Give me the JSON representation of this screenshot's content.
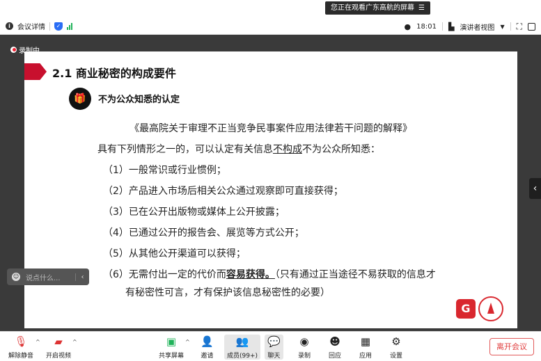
{
  "share_banner": {
    "text": "您正在观看广东高航的屏幕",
    "menu_icon": "menu-icon"
  },
  "info_bar": {
    "meeting_details": "会议详情",
    "time": "18:01",
    "view_mode": "演讲者视图",
    "colors": {
      "shield": "#2a6df5",
      "signal": "#21b35b"
    }
  },
  "recording": {
    "label": "录制中"
  },
  "slide": {
    "heading": "2.1 商业秘密的构成要件",
    "subheading": "不为公众知悉的认定",
    "law_title": "《最高院关于审理不正当竞争民事案件应用法律若干问题的解释》",
    "lead_pre": "具有下列情形之一的，可以认定有关信息",
    "lead_underline": "不构成",
    "lead_post": "不为公众所知悉：",
    "items": [
      "（1）一般常识或行业惯例；",
      "（2）产品进入市场后相关公众通过观察即可直接获得；",
      "（3）已在公开出版物或媒体上公开披露；",
      "（4）已通过公开的报告会、展览等方式公开；",
      "（5）从其他公开渠道可以获得；"
    ],
    "item6_pre": "（6）无需付出一定的代价而",
    "item6_bold": "容易获得。",
    "item6_post": "（只有通过正当途径不易获取的信息才",
    "item6_line2": "有秘密性可言，才有保护该信息秘密性的必要）",
    "accent": "#c8102e"
  },
  "chat": {
    "placeholder": "说点什么..."
  },
  "toolbar": {
    "unmute": "解除静音",
    "start_video": "开启视频",
    "share_screen": "共享屏幕",
    "invite": "邀请",
    "members": "成员(99+)",
    "chat": "聊天",
    "record": "录制",
    "reactions": "回应",
    "apps": "应用",
    "settings": "设置",
    "leave": "离开会议"
  }
}
